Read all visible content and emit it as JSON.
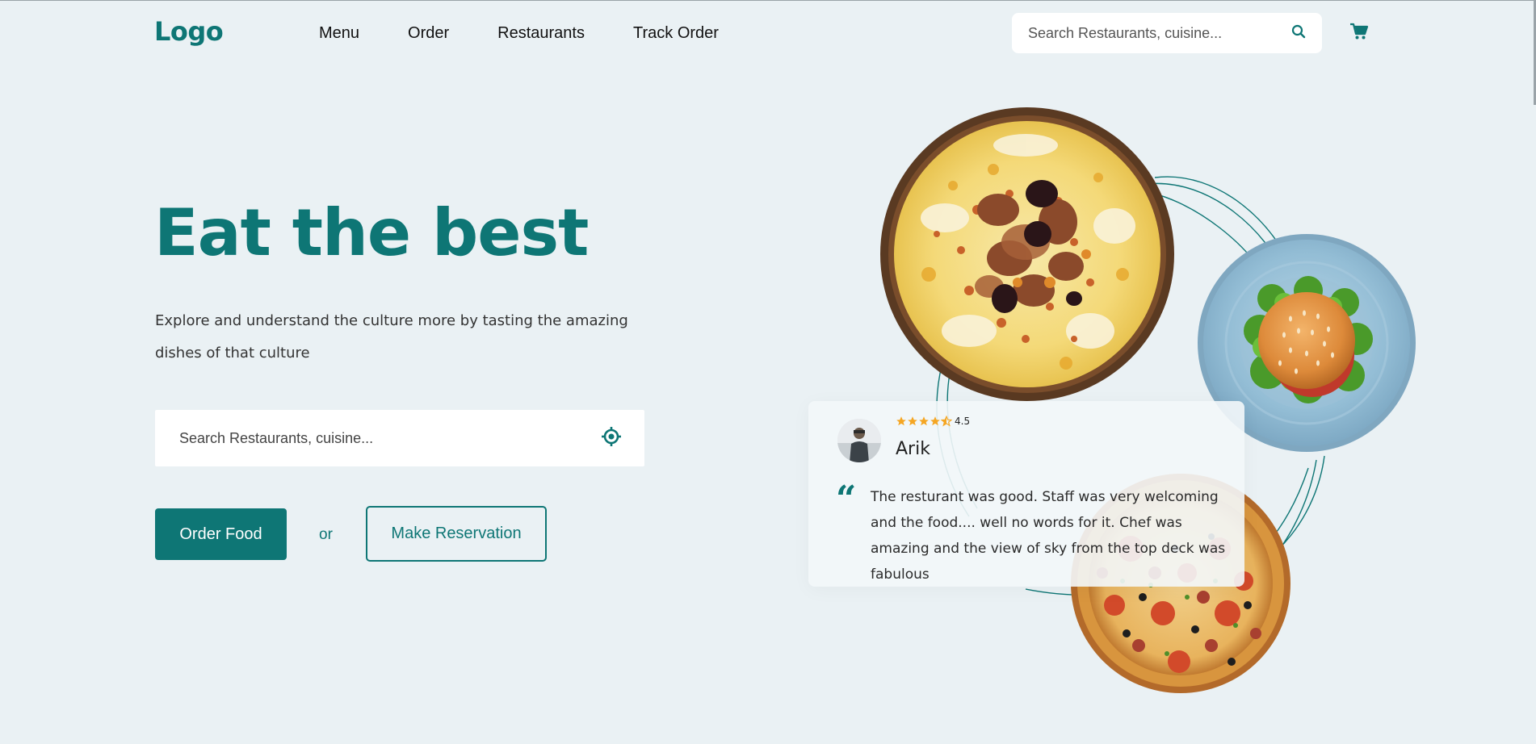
{
  "header": {
    "logo": "Logo",
    "nav": [
      {
        "label": "Menu"
      },
      {
        "label": "Order"
      },
      {
        "label": "Restaurants"
      },
      {
        "label": "Track Order"
      }
    ],
    "search_placeholder": "Search Restaurants, cuisine..."
  },
  "hero": {
    "headline": "Eat the best",
    "subtext": "Explore and understand the culture more by tasting the amazing dishes of that culture",
    "search_placeholder": "Search Restaurants, cuisine...",
    "order_button": "Order Food",
    "or_text": "or",
    "reserve_button": "Make Reservation"
  },
  "review": {
    "rating": "4.5",
    "rating_value": 4.5,
    "name": "Arik",
    "quote": "The resturant was good. Staff was very welcoming and the food.... well no words for it. Chef was amazing and the view of sky from the top deck was fabulous"
  },
  "colors": {
    "brand": "#0e7675",
    "background": "#eaf1f4",
    "star": "#f5a623"
  },
  "icons": {
    "search": "search-icon",
    "cart": "cart-icon",
    "location": "location-target-icon",
    "quote": "quote-icon",
    "star": "star-icon"
  }
}
